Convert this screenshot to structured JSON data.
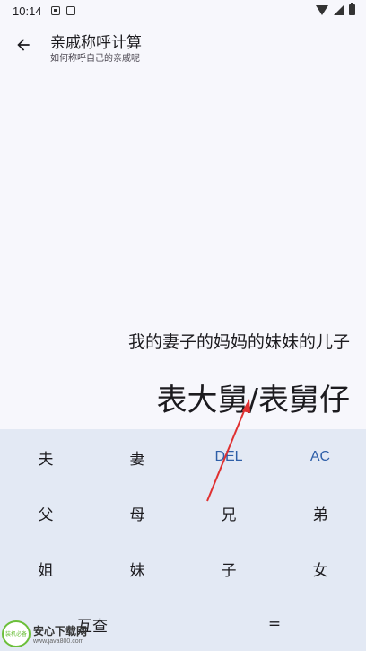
{
  "status_bar": {
    "time": "10:14"
  },
  "app_bar": {
    "title": "亲戚称呼计算",
    "subtitle": "如何称呼自己的亲戚呢"
  },
  "display": {
    "expression": "我的妻子的妈妈的妹妹的儿子",
    "result": "表大舅/表舅仔"
  },
  "keypad": {
    "keys": [
      {
        "label": "夫",
        "type": "relation"
      },
      {
        "label": "妻",
        "type": "relation"
      },
      {
        "label": "DEL",
        "type": "function"
      },
      {
        "label": "AC",
        "type": "function"
      },
      {
        "label": "父",
        "type": "relation"
      },
      {
        "label": "母",
        "type": "relation"
      },
      {
        "label": "兄",
        "type": "relation"
      },
      {
        "label": "弟",
        "type": "relation"
      },
      {
        "label": "姐",
        "type": "relation"
      },
      {
        "label": "妹",
        "type": "relation"
      },
      {
        "label": "子",
        "type": "relation"
      },
      {
        "label": "女",
        "type": "relation"
      },
      {
        "label": "互查",
        "type": "relation"
      },
      {
        "label": "=",
        "type": "relation"
      }
    ],
    "function_color": "#2f5fa8",
    "background": "#e3e9f4"
  },
  "annotation": {
    "arrow_color": "#e03030"
  },
  "watermark": {
    "name": "安心下载网",
    "url": "www.java800.com",
    "logo_text": "装机必备"
  }
}
